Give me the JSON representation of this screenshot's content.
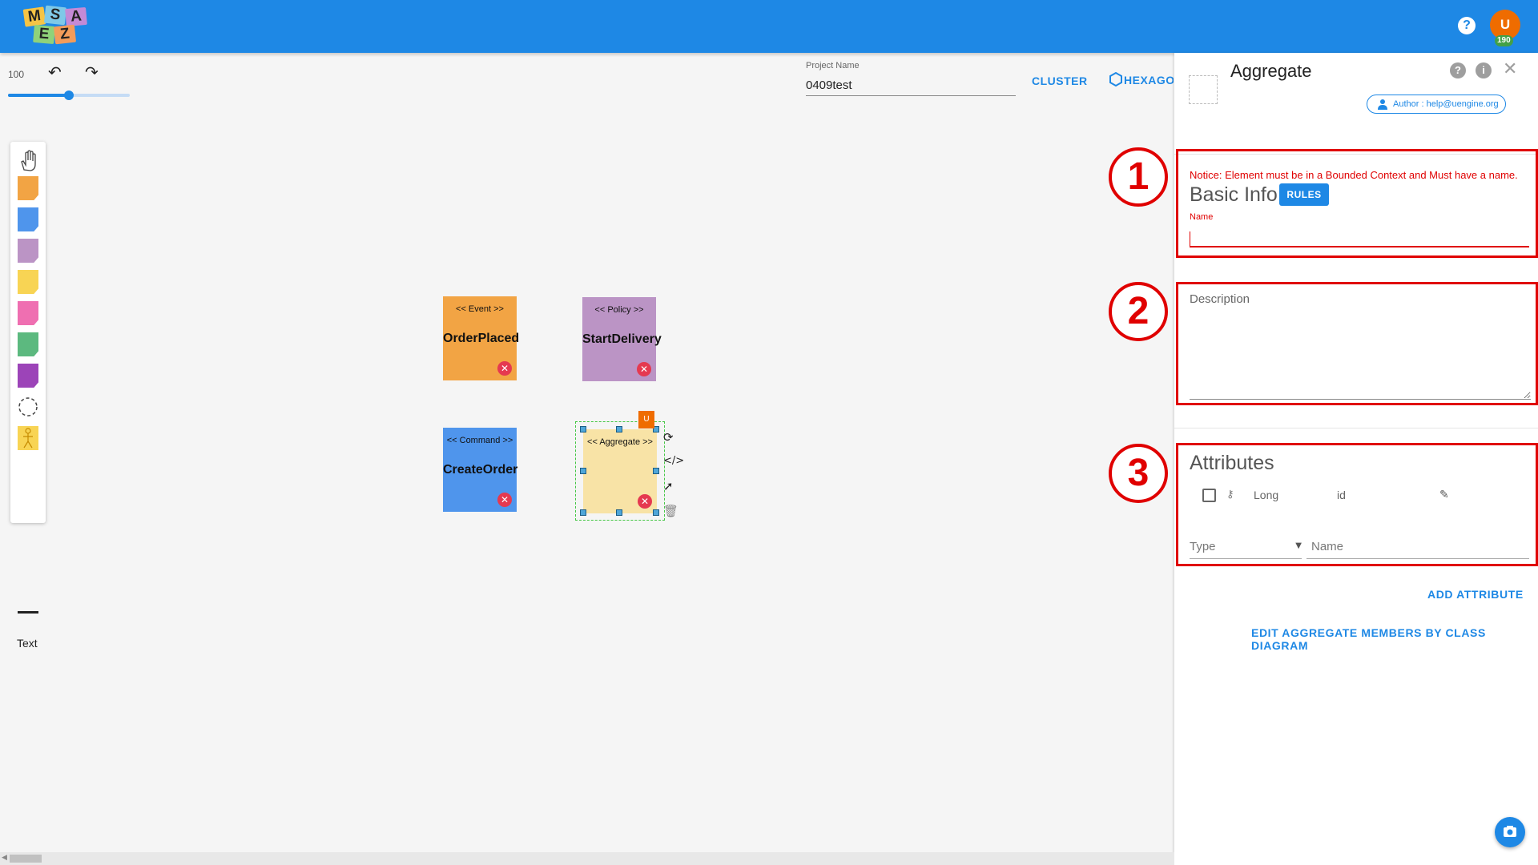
{
  "app": {
    "logo_letters": [
      "M",
      "S",
      "A",
      "E",
      "Z"
    ],
    "help_icon": "question-circle-icon",
    "user_initial": "U",
    "user_badge": "190"
  },
  "toolbar": {
    "zoom_value": "100",
    "zoom_level": 0.5,
    "undo_icon": "undo-icon",
    "redo_icon": "redo-icon",
    "project_name_label": "Project Name",
    "project_name_value": "0409test",
    "cluster_label": "CLUSTER",
    "hexagonal_label": "HEXAGONAL"
  },
  "palette": {
    "items": [
      {
        "name": "hand-tool-icon"
      },
      {
        "name": "event-sticker",
        "color": "#f2a444"
      },
      {
        "name": "command-sticker",
        "color": "#4f95ec"
      },
      {
        "name": "policy-sticker",
        "color": "#bb94c5"
      },
      {
        "name": "aggregate-sticker",
        "color": "#f8d454"
      },
      {
        "name": "external-sticker",
        "color": "#ef6fb1"
      },
      {
        "name": "read-model-sticker",
        "color": "#5cb97f"
      },
      {
        "name": "ui-sticker",
        "color": "#9c44b8"
      },
      {
        "name": "bounded-context-icon"
      },
      {
        "name": "actor-icon"
      },
      {
        "name": "line-tool"
      }
    ],
    "text_label": "Text"
  },
  "canvas": {
    "stickies": [
      {
        "stereotype": "<< Event >>",
        "name": "OrderPlaced",
        "color": "#f2a444"
      },
      {
        "stereotype": "<< Policy >>",
        "name": "StartDelivery",
        "color": "#bb94c5"
      },
      {
        "stereotype": "<< Command >>",
        "name": "CreateOrder",
        "color": "#4f95ec"
      },
      {
        "stereotype": "<< Aggregate >>",
        "name": "",
        "color": "#f8e3a6"
      }
    ],
    "selected_tag": "U",
    "delete_icon": "close-circle-icon"
  },
  "panel": {
    "title": "Aggregate",
    "author": "Author : help@uengine.org",
    "notice": "Notice: Element must be in a Bounded Context and Must have a name.",
    "basic_info": "Basic Info",
    "rules_label": "RULES",
    "name_label": "Name",
    "name_value": "",
    "description_label": "Description",
    "attributes_title": "Attributes",
    "attribute_rows": [
      {
        "type": "Long",
        "name": "id",
        "is_key": true
      }
    ],
    "type_placeholder": "Type",
    "name_placeholder": "Name",
    "add_attribute_label": "ADD ATTRIBUTE",
    "edit_members_label": "EDIT AGGREGATE MEMBERS BY CLASS DIAGRAM",
    "markers": [
      "1",
      "2",
      "3"
    ],
    "highlight_color": "#e00000"
  }
}
